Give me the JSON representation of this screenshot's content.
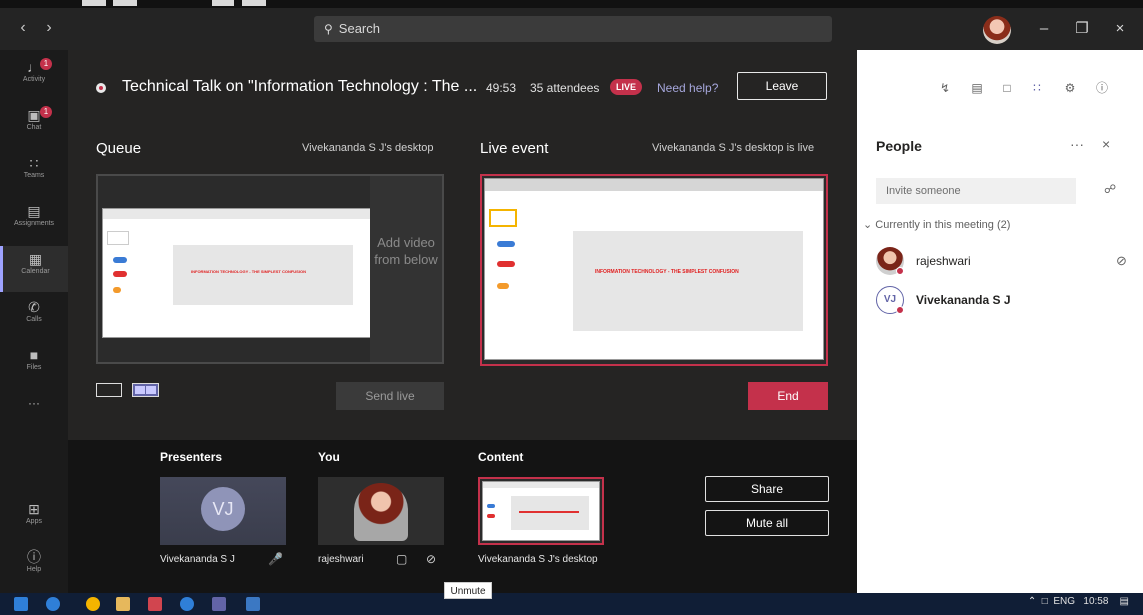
{
  "titlebar": {
    "back_icon": "chevron-left-icon",
    "forward_icon": "chevron-right-icon",
    "search_placeholder": "Search",
    "back_glyph": "‹",
    "forward_glyph": "›",
    "minimize_glyph": "–",
    "maximize_glyph": "❐",
    "close_glyph": "×"
  },
  "rail": {
    "items": [
      {
        "label": "Activity",
        "badge": "1"
      },
      {
        "label": "Chat",
        "badge": "1"
      },
      {
        "label": "Teams"
      },
      {
        "label": "Assignments"
      },
      {
        "label": "Calendar"
      },
      {
        "label": "Calls"
      },
      {
        "label": "Files"
      },
      {
        "label": "Apps"
      },
      {
        "label": "Help"
      }
    ],
    "more": "···"
  },
  "meeting": {
    "title": "Technical Talk on \"Information Technology : The ...",
    "timer": "49:53",
    "attendees": "35 attendees",
    "live_badge": "LIVE",
    "help": "Need help?",
    "leave": "Leave"
  },
  "queue": {
    "heading": "Queue",
    "source": "Vivekananda S J's desktop",
    "add_hint": "Add video from below",
    "send_live": "Send live"
  },
  "live": {
    "heading": "Live event",
    "status": "Vivekananda S J's desktop is live",
    "end": "End"
  },
  "slide": {
    "text": "INFORMATION TECHNOLOGY - THE SIMPLEST CONFUSION"
  },
  "bottom": {
    "presenters": "Presenters",
    "you": "You",
    "content": "Content",
    "presenter_initials": "VJ",
    "presenter_name": "Vivekananda S J",
    "you_name": "rajeshwari",
    "content_name": "Vivekananda S J's desktop",
    "share": "Share",
    "mute_all": "Mute all"
  },
  "people": {
    "heading": "People",
    "more": "···",
    "close": "×",
    "invite_placeholder": "Invite someone",
    "section": "Currently in this meeting (2)",
    "members": [
      {
        "name": "rajeshwari"
      },
      {
        "name": "Vivekananda S J",
        "initials": "VJ"
      }
    ]
  },
  "taskbar": {
    "lang": "ENG",
    "time": "10:58"
  },
  "tooltip": "Unmute",
  "colors": {
    "accent": "#6264a7",
    "live_red": "#c4314b",
    "background": "#252423",
    "panel": "#ffffff"
  }
}
